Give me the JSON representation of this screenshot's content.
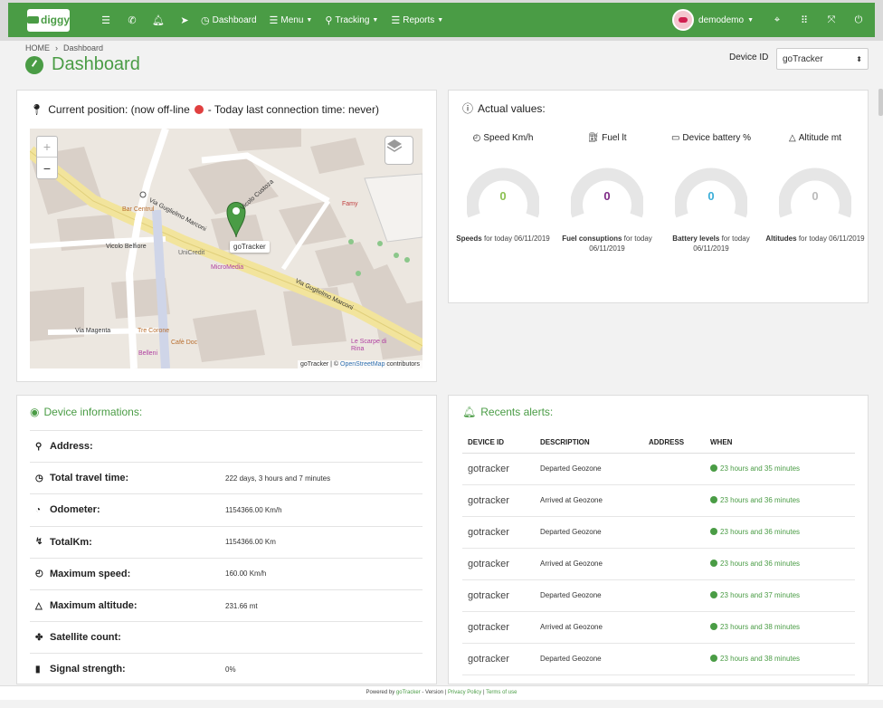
{
  "nav": {
    "logo": "diggy",
    "dashboard": "Dashboard",
    "menu": "Menu",
    "tracking": "Tracking",
    "reports": "Reports",
    "user": "demodemo"
  },
  "breadcrumb": {
    "home": "HOME",
    "current": "Dashboard"
  },
  "page_title": "Dashboard",
  "device_selector": {
    "label": "Device ID",
    "value": "goTracker"
  },
  "map_panel": {
    "title": "Current position: (now off-line",
    "title_suffix": "- Today last connection time: never)",
    "marker_label": "goTracker",
    "attribution_pre": "goTracker | ©",
    "attribution_link": "OpenStreetMap",
    "attribution_post": "contributors",
    "streets": [
      "Via Guglielmo Marconi",
      "Via Guglielmo Marconi",
      "Vicolo Custoza",
      "Vicolo Belfiore",
      "Via Magenta"
    ],
    "pois": [
      "Bar Centrul",
      "UniCredit",
      "MicroMedia",
      "Tre Corone",
      "Cafè Doc",
      "Belleni",
      "Le Scarpe di Rina",
      "Famy"
    ]
  },
  "values_panel": {
    "title": "Actual values:",
    "gauges": [
      {
        "label": "Speed Km/h",
        "value": "0",
        "color": "#8cc152",
        "foot_bold": "Speeds",
        "foot": "for today 06/11/2019"
      },
      {
        "label": "Fuel lt",
        "value": "0",
        "color": "#7e2a86",
        "foot_bold": "Fuel consuptions",
        "foot": "for today 06/11/2019"
      },
      {
        "label": "Device battery %",
        "value": "0",
        "color": "#3aaed8",
        "foot_bold": "Battery levels",
        "foot": "for today 06/11/2019"
      },
      {
        "label": "Altitude mt",
        "value": "0",
        "color": "#bbbbbb",
        "foot_bold": "Altitudes",
        "foot": "for today 06/11/2019"
      }
    ]
  },
  "info_panel": {
    "title": "Device informations:",
    "rows": [
      {
        "key": "Address:",
        "value": ""
      },
      {
        "key": "Total travel time:",
        "value": "222 days, 3 hours and 7 minutes"
      },
      {
        "key": "Odometer:",
        "value": "1154366.00 Km/h"
      },
      {
        "key": "TotalKm:",
        "value": "1154366.00 Km"
      },
      {
        "key": "Maximum speed:",
        "value": "160.00 Km/h"
      },
      {
        "key": "Maximum altitude:",
        "value": "231.66 mt"
      },
      {
        "key": "Satellite count:",
        "value": ""
      },
      {
        "key": "Signal strength:",
        "value": "0%"
      }
    ]
  },
  "alerts_panel": {
    "title": "Recents alerts:",
    "columns": [
      "DEVICE ID",
      "DESCRIPTION",
      "ADDRESS",
      "WHEN"
    ],
    "rows": [
      {
        "device": "gotracker",
        "description": "Departed Geozone",
        "address": "",
        "when": "23 hours and 35 minutes"
      },
      {
        "device": "gotracker",
        "description": "Arrived at Geozone",
        "address": "",
        "when": "23 hours and 36 minutes"
      },
      {
        "device": "gotracker",
        "description": "Departed Geozone",
        "address": "",
        "when": "23 hours and 36 minutes"
      },
      {
        "device": "gotracker",
        "description": "Arrived at Geozone",
        "address": "",
        "when": "23 hours and 36 minutes"
      },
      {
        "device": "gotracker",
        "description": "Departed Geozone",
        "address": "",
        "when": "23 hours and 37 minutes"
      },
      {
        "device": "gotracker",
        "description": "Arrived at Geozone",
        "address": "",
        "when": "23 hours and 38 minutes"
      },
      {
        "device": "gotracker",
        "description": "Departed Geozone",
        "address": "",
        "when": "23 hours and 38 minutes"
      }
    ]
  },
  "footer": {
    "prefix": "Powered by",
    "brand": "goTracker",
    "version": "- Version",
    "privacy": "Privacy Policy",
    "terms": "Terms of use"
  }
}
